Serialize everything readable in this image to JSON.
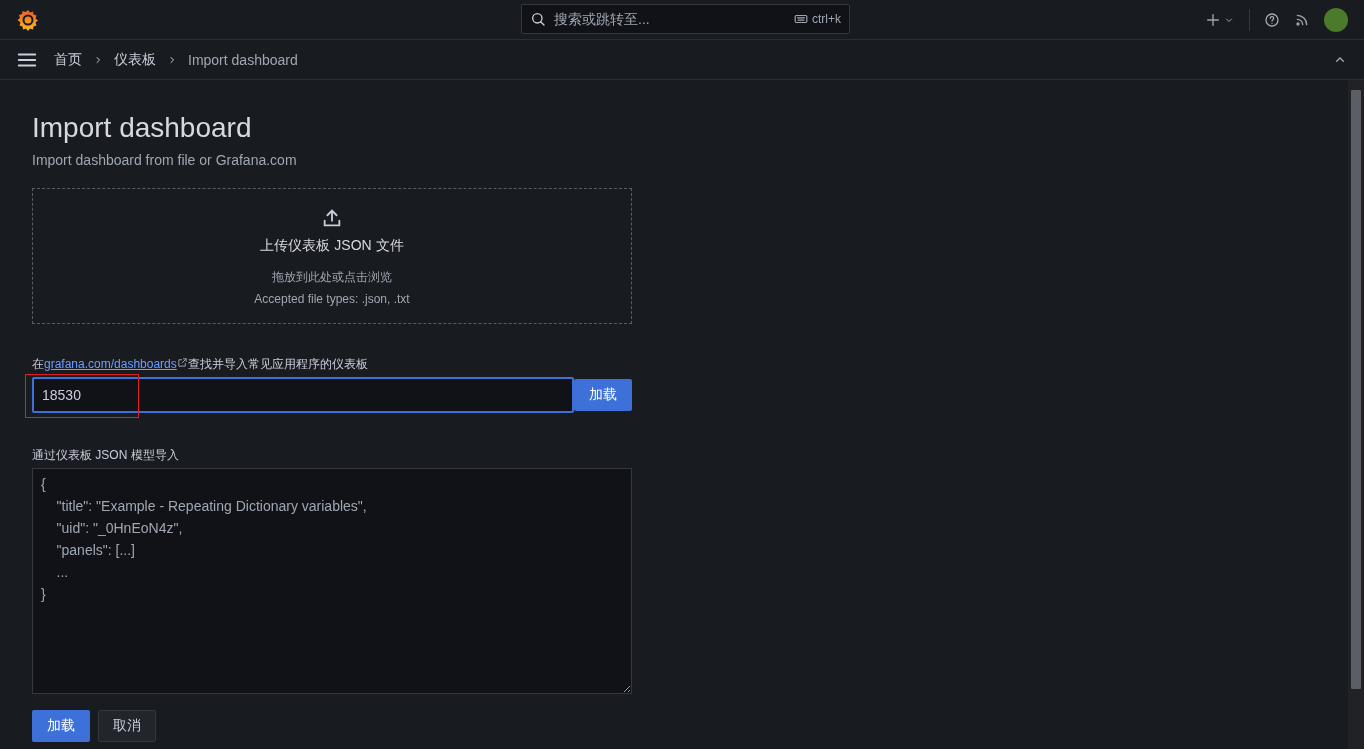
{
  "topbar": {
    "search": {
      "placeholder": "搜索或跳转至...",
      "shortcut": "ctrl+k"
    }
  },
  "breadcrumbs": [
    {
      "label": "首页",
      "current": false
    },
    {
      "label": "仪表板",
      "current": false
    },
    {
      "label": "Import dashboard",
      "current": true
    }
  ],
  "page": {
    "title": "Import dashboard",
    "subtitle": "Import dashboard from file or Grafana.com"
  },
  "upload": {
    "title": "上传仪表板 JSON 文件",
    "hint": "拖放到此处或点击浏览",
    "file_types": "Accepted file types: .json, .txt"
  },
  "grafana_com": {
    "label_before": "在",
    "link": "grafana.com/dashboards",
    "label_after": "查找并导入常见应用程序的仪表板",
    "value": "18530",
    "highlighted": true,
    "button": "加载"
  },
  "json_model": {
    "label": "通过仪表板 JSON 模型导入",
    "placeholder_lines": [
      "{",
      "    \"title\": \"Example - Repeating Dictionary variables\",",
      "    \"uid\": \"_0HnEoN4z\",",
      "    \"panels\": [...]",
      "    ...",
      "}"
    ]
  },
  "buttons": [
    {
      "label": "加载",
      "kind": "primary"
    },
    {
      "label": "取消",
      "kind": "secondary"
    }
  ]
}
